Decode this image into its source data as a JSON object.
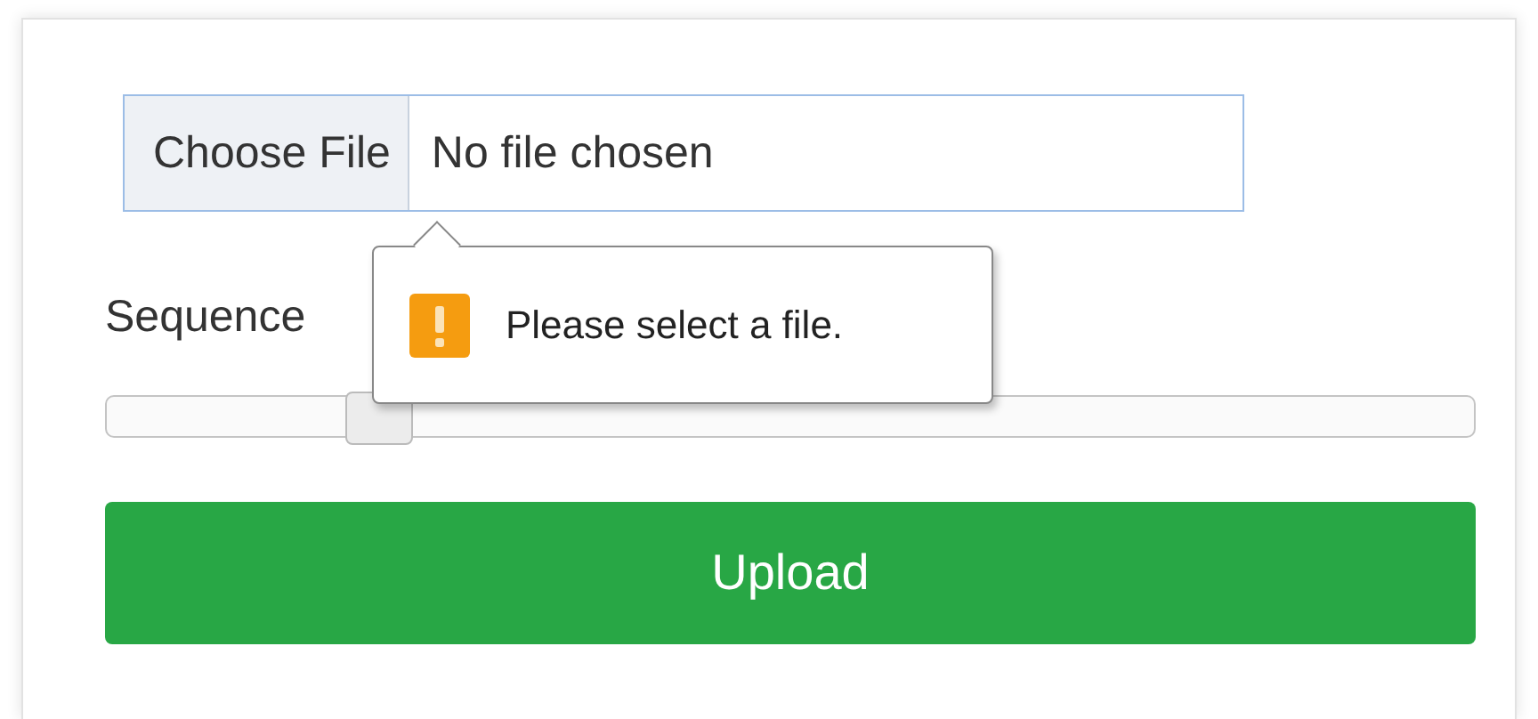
{
  "file_input": {
    "button": "Choose File",
    "status": "No file chosen"
  },
  "tooltip": {
    "message": "Please select a file."
  },
  "slider": {
    "label": "Sequence",
    "level": 0.2
  },
  "buttons": [
    "Upload"
  ]
}
